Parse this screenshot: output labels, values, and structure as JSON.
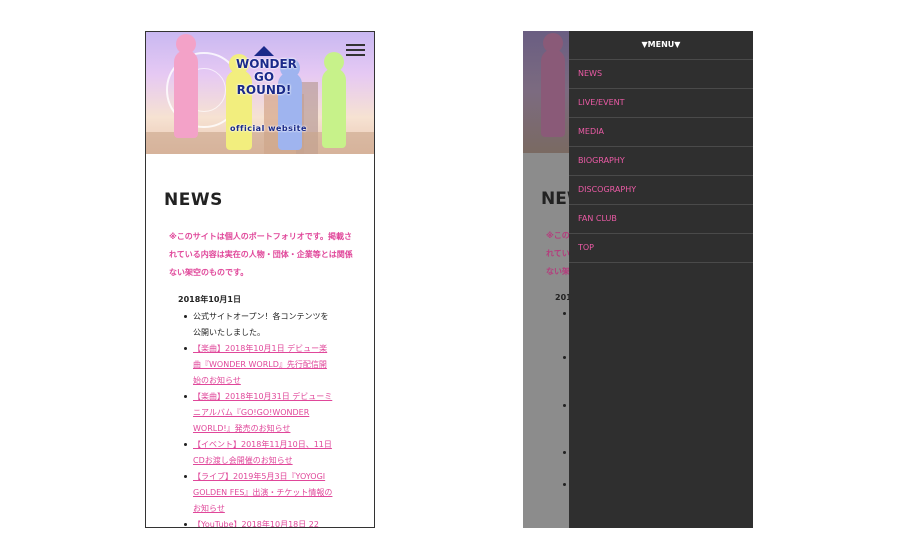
{
  "site": {
    "logo_lines": [
      "WONDER",
      "GO",
      "ROUND!"
    ],
    "logo_subtitle": "official website"
  },
  "news_page": {
    "title": "NEWS",
    "notice": "※このサイトは個人のポートフォリオです。掲載されている内容は実在の人物・団体・企業等とは関係ない架空のものです。",
    "date": "2018年10月1日",
    "items": [
      {
        "text": "公式サイトオープン！各コンテンツを公開いたしました。",
        "link": false
      },
      {
        "text": "【楽曲】2018年10月1日 デビュー楽曲『WONDER WORLD』先行配信開始のお知らせ",
        "link": true
      },
      {
        "text": "【楽曲】2018年10月31日 デビューミニアルバム『GO!GO!WONDER WORLD!』発売のお知らせ",
        "link": true
      },
      {
        "text": "【イベント】2018年11月10日、11日 CDお渡し会開催のお知らせ",
        "link": true
      },
      {
        "text": "【ライブ】2019年5月3日『YOYOGI GOLDEN FES』出演・チケット情報のお知らせ",
        "link": true
      },
      {
        "text": "【YouTube】2018年10月18日 22",
        "link": true
      }
    ]
  },
  "menu": {
    "header": "▼MENU▼",
    "items": [
      "NEWS",
      "LIVE/EVENT",
      "MEDIA",
      "BIOGRAPHY",
      "DISCOGRAPHY",
      "FAN CLUB",
      "TOP"
    ]
  },
  "dimmed_background": {
    "title": "NEWS",
    "notice_lines": [
      "※この",
      "れてい",
      "ない架"
    ],
    "date": "201"
  },
  "colors": {
    "accent_pink": "#e0479a",
    "menu_bg": "#2f2f2f",
    "menu_text": "#ec5ba6",
    "overlay": "#808080"
  },
  "icons": {
    "menu_toggle": "hamburger-icon"
  }
}
